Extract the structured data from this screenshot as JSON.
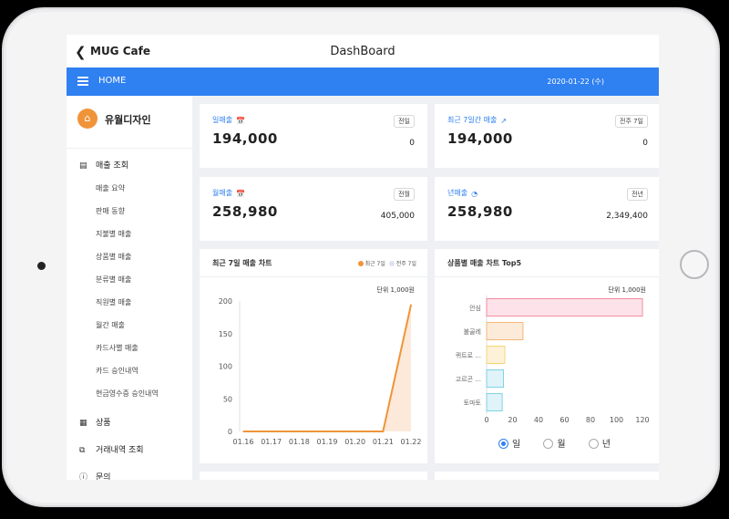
{
  "header": {
    "back_icon": "chevron-left-icon",
    "app_name": "MUG Cafe",
    "page_title": "DashBoard"
  },
  "navbar": {
    "menu_icon": "hamburger-icon",
    "label": "HOME",
    "date": "2020-01-22 (수)"
  },
  "sidebar": {
    "brand": "유월디자인",
    "sales_header": "매출 조회",
    "sales_items": [
      "매출 요약",
      "판매 동향",
      "지불별 매출",
      "상품별 매출",
      "분류별 매출",
      "직원별 매출",
      "월간 매출",
      "카드사별 매출",
      "카드 승인내역",
      "현금영수증 승인내역"
    ],
    "products": "상품",
    "transactions": "거래내역 조회",
    "inquiry": "문의"
  },
  "cards": [
    {
      "label": "일매출",
      "badge": "전일",
      "value": "194,000",
      "compare": "0",
      "icon": "calendar-icon"
    },
    {
      "label": "최근 7일간 매출",
      "badge": "전주 7일",
      "value": "194,000",
      "compare": "0",
      "icon": "line-chart-icon"
    },
    {
      "label": "월매출",
      "badge": "전월",
      "value": "258,980",
      "compare": "405,000",
      "icon": "calendar-icon"
    },
    {
      "label": "년매출",
      "badge": "전년",
      "value": "258,980",
      "compare": "2,349,400",
      "icon": "pie-chart-icon"
    }
  ],
  "colors": {
    "accent": "#2f80f1",
    "line": "#f0943a",
    "brand": "#f0943a"
  },
  "chart_data": [
    {
      "type": "area",
      "title": "최근 7일 매출 차트",
      "unit": "단위 1,000원",
      "categories": [
        "01.16",
        "01.17",
        "01.18",
        "01.19",
        "01.20",
        "01.21",
        "01.22"
      ],
      "series": [
        {
          "name": "최근 7일",
          "values": [
            0,
            0,
            0,
            0,
            0,
            0,
            194
          ]
        },
        {
          "name": "전주 7일",
          "values": [
            0,
            0,
            0,
            0,
            0,
            0,
            0
          ]
        }
      ],
      "yticks": [
        0,
        50,
        100,
        150,
        200
      ],
      "ylim": [
        0,
        200
      ],
      "legend": "top-right"
    },
    {
      "type": "bar",
      "orientation": "horizontal",
      "title": "상품별 매출 차트 Top5",
      "unit": "단위 1,000원",
      "categories": [
        "안심",
        "불골레",
        "퀴트로 ...",
        "고르곤 ...",
        "토마토"
      ],
      "values": [
        120,
        28,
        14,
        13,
        12
      ],
      "colors": [
        "#f28ba0",
        "#f6b77a",
        "#f6d57a",
        "#7fd3e6",
        "#7fd3e6"
      ],
      "fills": [
        "#fde3e9",
        "#fdebd9",
        "#fdf2d8",
        "#dff3f8",
        "#dff3f8"
      ],
      "xticks": [
        0,
        20,
        40,
        60,
        80,
        100,
        120
      ],
      "xlim": [
        0,
        120
      ]
    }
  ],
  "period_options": [
    {
      "label": "일",
      "selected": true
    },
    {
      "label": "월",
      "selected": false
    },
    {
      "label": "년",
      "selected": false
    }
  ]
}
